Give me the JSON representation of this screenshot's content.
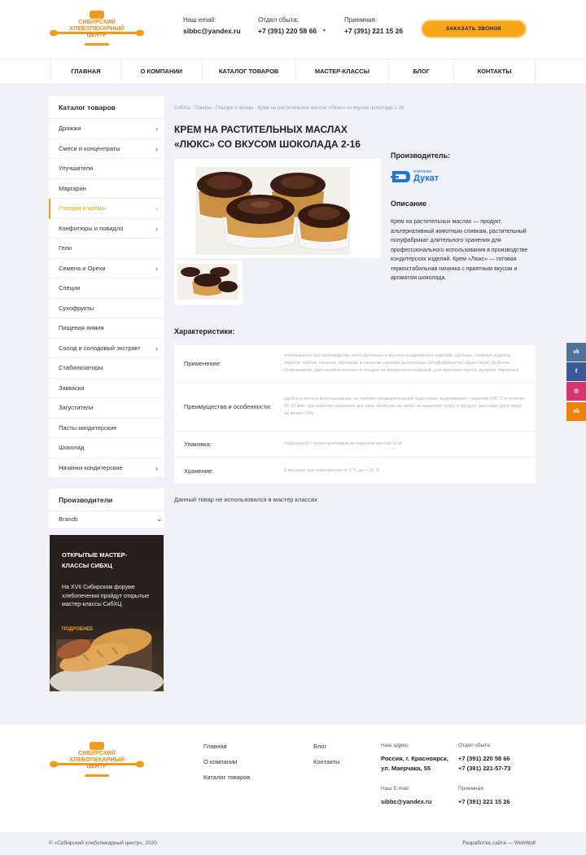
{
  "header": {
    "logo_text": "СИБИРСКИЙ ХЛЕБОПЕКАРНЫЙ ЦЕНТР",
    "email_label": "Наш email:",
    "email": "sibbc@yandex.ru",
    "sales_label": "Отдел сбыта:",
    "sales_phone": "+7 (391) 220 58 66",
    "reception_label": "Приемная:",
    "reception_phone": "+7 (391) 221 15 26",
    "call_button": "Заказать звонок"
  },
  "nav": {
    "items": [
      {
        "label": "Главная"
      },
      {
        "label": "О компании"
      },
      {
        "label": "Каталог товаров"
      },
      {
        "label": "Мастер-классы"
      },
      {
        "label": "Блог"
      },
      {
        "label": "Контакты"
      }
    ]
  },
  "sidebar": {
    "title": "Каталог товаров",
    "items": [
      {
        "label": "Дрожжи",
        "has_children": true
      },
      {
        "label": "Смеси и концентраты",
        "has_children": true
      },
      {
        "label": "Улучшители",
        "has_children": false
      },
      {
        "label": "Маргарин",
        "has_children": false
      },
      {
        "label": "Глазури и кремы",
        "has_children": true,
        "active": true
      },
      {
        "label": "Конфитюры и повидло",
        "has_children": true
      },
      {
        "label": "Гели",
        "has_children": false
      },
      {
        "label": "Семена и Орехи",
        "has_children": true
      },
      {
        "label": "Специи",
        "has_children": false
      },
      {
        "label": "Сухофрукты",
        "has_children": false
      },
      {
        "label": "Пищевая химия",
        "has_children": false
      },
      {
        "label": "Солод и солодовый экстракт",
        "has_children": true
      },
      {
        "label": "Стабилизаторы",
        "has_children": false
      },
      {
        "label": "Закваски",
        "has_children": false
      },
      {
        "label": "Загустители",
        "has_children": false
      },
      {
        "label": "Пасты кондитерские",
        "has_children": false
      },
      {
        "label": "Шоколад",
        "has_children": false
      },
      {
        "label": "Начинки кондитерские",
        "has_children": true
      }
    ]
  },
  "makers": {
    "title": "Производители",
    "selected": "Brands"
  },
  "promo": {
    "title": "Открытые мастер-классы СибХЦ",
    "text": "На XVII Сибирском форуме хлебопечения пройдут открытые мастер-классы СибХЦ",
    "more": "Подробнее"
  },
  "product": {
    "breadcrumbs": "СибХЦ - Товары - Глазури и кремы - Крем на растительных маслах «Люкс» со вкусом шоколада 2-16",
    "title": "Крем на растительных маслах «Люкс» со вкусом шоколада 2-16",
    "manufacturer_label": "Производитель:",
    "brand_small": "компания",
    "brand_name": "Дукат",
    "description_label": "Описание",
    "description": "Крем на растительных маслах — продукт, альтернативный животным сливкам, растительный полуфабрикат длительного хранения для профессионального использования в производстве кондитерских изделий. Крем «Люкс» — готовая термостабильная начинка с приятным вкусом и ароматом шоколада.",
    "characteristics_label": "Характеристики:",
    "characteristics": [
      {
        "key": "Применение:",
        "value": "используется при производстве хлебобулочных и мучных кондитерских изделий: сдобных, слоёных изделий, пирогов, кексов, печенья, пряников, в качестве начинки выпеченных полуфабрикатов: круассанов, трубочек (Берлинеров), для склейки печенья и отсадки на поверхности изделий, для прослоек тортов, рулетов, пирожных"
      },
      {
        "key": "Преимущества и особенности:",
        "value": "удобен и легок в использовании, не требует предварительной подготовки, выдерживает t выпечки 200 ˚С в течение 15-20 мин. при выпечке сохраняет все свои свойства, не кипит, не выделяет влагу в продукт, массовая доля жира: не менее 10%"
      },
      {
        "key": "Упаковка:",
        "value": "гофрокороб с полиэтиленовым вкладышем массой 10 кг."
      },
      {
        "key": "Хранение:",
        "value": "6 месяцев при температуре от 0 ˚С до + 10 ˚С"
      }
    ],
    "note": "Данный товар не использовался в мастер классах"
  },
  "social": [
    {
      "name": "vk",
      "glyph": "vk",
      "color": "#507299"
    },
    {
      "name": "facebook",
      "glyph": "f",
      "color": "#3b5998"
    },
    {
      "name": "instagram",
      "glyph": "◎",
      "color": "#d6366f"
    },
    {
      "name": "odnoklassniki",
      "glyph": "ok",
      "color": "#ee8208"
    }
  ],
  "footer": {
    "logo_text": "СИБИРСКИЙ ХЛЕБОПЕКАРНЫЙ ЦЕНТР",
    "links_col1": [
      "Главная",
      "О компании",
      "Каталог товаров"
    ],
    "links_col2": [
      "Блог",
      "Контакты"
    ],
    "address_label": "Наш адрес:",
    "address": "Россия, г. Красноярск, ул. Маерчака, 55",
    "sales_label": "Отдел сбыта:",
    "sales_phones": "+7 (391) 220 58 66\n+7 (391) 221-57-73",
    "email_label": "Наш E-mail:",
    "email": "sibbc@yandex.ru",
    "reception_label": "Приемная:",
    "reception_phone": "+7 (391) 221 15 26",
    "copyright": "© «Сибирский хлебопекарный центр», 2020.",
    "developer": "Разработка сайта — WebWolf"
  }
}
